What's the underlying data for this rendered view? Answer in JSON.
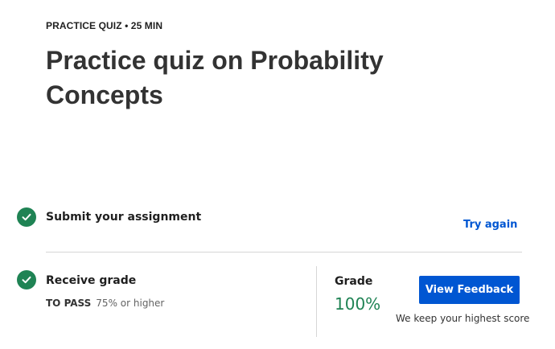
{
  "header": {
    "meta": "PRACTICE QUIZ • 25 MIN",
    "title": "Practice quiz on Probability Concepts"
  },
  "steps": [
    {
      "icon": "checkmark-icon",
      "label": "Submit your assignment",
      "action_label": "Try again"
    },
    {
      "icon": "checkmark-icon",
      "label": "Receive grade",
      "pass_key": "TO PASS",
      "pass_value": "75% or higher"
    }
  ],
  "grade": {
    "label": "Grade",
    "value": "100%",
    "button_label": "View Feedback",
    "note": "We keep your highest score"
  },
  "colors": {
    "success": "#1f8354",
    "primary": "#0056d2",
    "divider": "#d6d6d6"
  }
}
